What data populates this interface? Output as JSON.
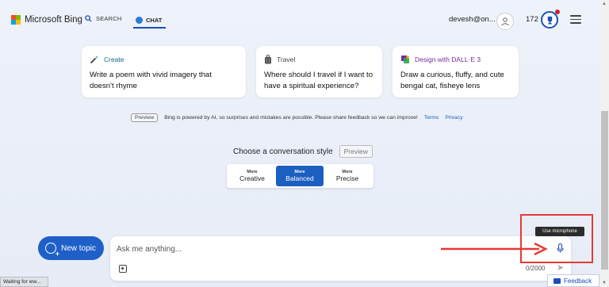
{
  "header": {
    "brand": "Microsoft Bing",
    "nav_search": "SEARCH",
    "nav_chat": "CHAT",
    "user_name": "devesh@on...",
    "points": "172"
  },
  "cards": [
    {
      "label": "Create",
      "text": "Write a poem with vivid imagery that doesn't rhyme",
      "icon": "magic-wand-icon"
    },
    {
      "label": "Travel",
      "text": "Where should I travel if I want to have a spiritual experience?",
      "icon": "luggage-icon"
    },
    {
      "label": "Design with DALL·E 3",
      "text": "Draw a curious, fluffy, and cute bengal cat, fisheye lens",
      "icon": "paint-icon"
    }
  ],
  "disclaimer": {
    "badge": "Preview",
    "text": "Bing is powered by AI, so surprises and mistakes are possible. Please share feedback so we can improve!",
    "terms": "Terms",
    "privacy": "Privacy"
  },
  "style_picker": {
    "title": "Choose a conversation style",
    "badge": "Preview",
    "options": [
      {
        "small": "More",
        "label": "Creative"
      },
      {
        "small": "More",
        "label": "Balanced"
      },
      {
        "small": "More",
        "label": "Precise"
      }
    ],
    "selected": "Balanced"
  },
  "composer": {
    "new_topic": "New topic",
    "placeholder": "Ask me anything...",
    "counter": "0/2000"
  },
  "annotations": {
    "tooltip": "Use microphone",
    "highlight_color": "#e53935"
  },
  "status_bar": "Waiting for ww...",
  "feedback": "Feedback",
  "colors": {
    "accent": "#1f5fc8"
  }
}
